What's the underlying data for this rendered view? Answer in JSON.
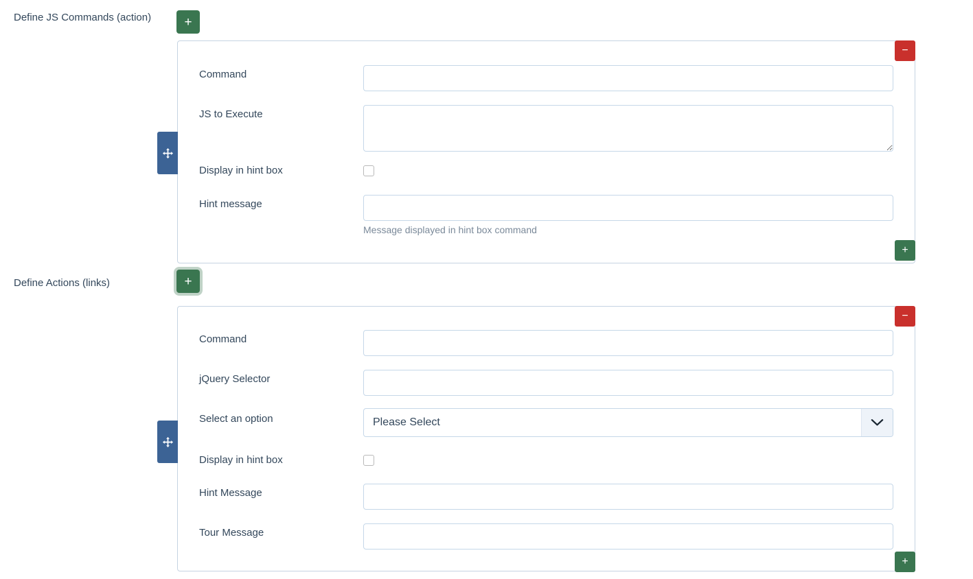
{
  "sections": [
    {
      "id": "js-commands",
      "label": "Define JS Commands (action)",
      "add_button_label": "+",
      "add_button_focused": false,
      "panel": {
        "remove_button_label": "−",
        "add_row_button_label": "+",
        "drag_handle_icon": "move-arrows-icon",
        "fields": [
          {
            "label": "Command",
            "type": "text",
            "value": "",
            "placeholder": ""
          },
          {
            "label": "JS to Execute",
            "type": "textarea",
            "value": "",
            "placeholder": ""
          },
          {
            "label": "Display in hint box",
            "type": "checkbox",
            "checked": false
          },
          {
            "label": "Hint message",
            "type": "text",
            "value": "",
            "placeholder": "",
            "help": "Message displayed in hint box command"
          }
        ]
      }
    },
    {
      "id": "actions-links",
      "label": "Define Actions (links)",
      "add_button_label": "+",
      "add_button_focused": true,
      "panel": {
        "remove_button_label": "−",
        "add_row_button_label": "+",
        "drag_handle_icon": "move-arrows-icon",
        "fields": [
          {
            "label": "Command",
            "type": "text",
            "value": "",
            "placeholder": ""
          },
          {
            "label": "jQuery Selector",
            "type": "text",
            "value": "",
            "placeholder": ""
          },
          {
            "label": "Select an option",
            "type": "select",
            "value": "Please Select",
            "options": [
              "Please Select"
            ]
          },
          {
            "label": "Display in hint box",
            "type": "checkbox",
            "checked": false
          },
          {
            "label": "Hint Message",
            "type": "text",
            "value": "",
            "placeholder": ""
          },
          {
            "label": "Tour Message",
            "type": "text",
            "value": "",
            "placeholder": ""
          }
        ]
      }
    }
  ],
  "colors": {
    "green": "#3a7650",
    "red": "#c9302c",
    "drag_blue": "#3c6395",
    "border": "#c5d3e2",
    "input_border": "#c5d7e8",
    "text": "#33475b",
    "help_text": "#7b8a9a"
  }
}
